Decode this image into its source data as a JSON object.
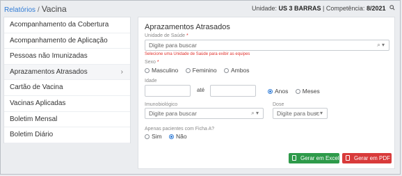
{
  "breadcrumb": {
    "link": "Relatórios",
    "separator": "/",
    "current": "Vacina"
  },
  "header": {
    "unit_label": "Unidade:",
    "unit_value": "US 3 BARRAS",
    "sep": "|",
    "comp_label": "Competência:",
    "comp_value": "8/2021"
  },
  "menu": {
    "items": [
      {
        "label": "Acompanhamento da Cobertura"
      },
      {
        "label": "Acompanhamento de Aplicação"
      },
      {
        "label": "Pessoas não Imunizadas"
      },
      {
        "label": "Aprazamentos Atrasados",
        "active": true,
        "chevron": "›"
      },
      {
        "label": "Cartão de Vacina"
      },
      {
        "label": "Vacinas Aplicadas"
      },
      {
        "label": "Boletim Mensal"
      },
      {
        "label": "Boletim Diário"
      }
    ]
  },
  "form": {
    "title": "Aprazamentos Atrasados",
    "unidade_label": "Unidade de Saúde",
    "required_mark": "*",
    "unidade_placeholder": "Digite para buscar",
    "unidade_error": "Selecione uma Unidade de Saúde para exibir as equipes",
    "sexo_label": "Sexo",
    "sexo_options": [
      "Masculino",
      "Feminino",
      "Ambos"
    ],
    "idade_label": "Idade",
    "idade_ate": "até",
    "idade_units": [
      "Anos",
      "Meses"
    ],
    "idade_unit_selected": "Anos",
    "imuno_label": "Imunobiológico",
    "imuno_placeholder": "Digite para buscar",
    "dose_label": "Dose",
    "dose_placeholder": "Digite para busc",
    "ficha_label": "Apenas pacientes com Ficha A?",
    "ficha_options": [
      "Sim",
      "Não"
    ],
    "ficha_selected": "Não"
  },
  "buttons": {
    "excel": "Gerar em Excel",
    "pdf": "Gerar em PDF"
  },
  "colors": {
    "link": "#2f7bd6",
    "excel": "#2e9a4a",
    "pdf": "#d83a3a",
    "error": "#e0312c"
  }
}
